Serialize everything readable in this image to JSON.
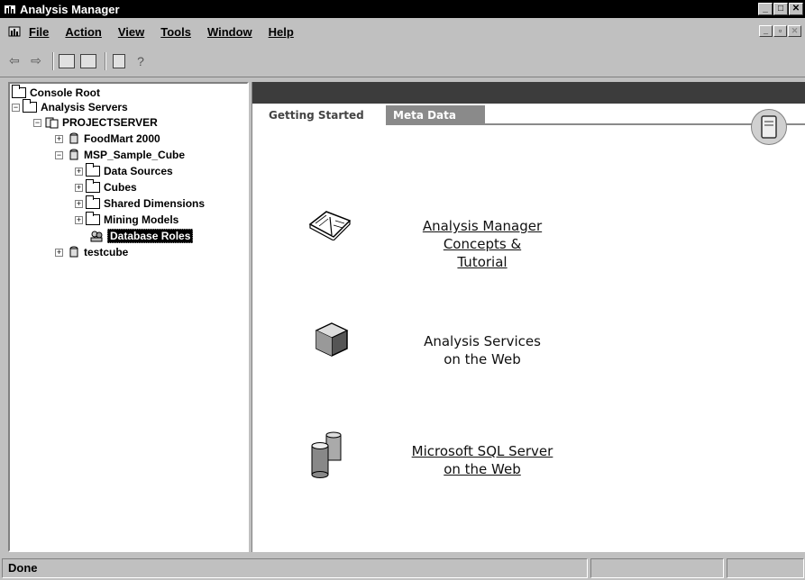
{
  "window": {
    "title": "Analysis Manager"
  },
  "menu": [
    {
      "label": "File"
    },
    {
      "label": "Action"
    },
    {
      "label": "View"
    },
    {
      "label": "Tools"
    },
    {
      "label": "Window"
    },
    {
      "label": "Help"
    }
  ],
  "tree": {
    "console_root": "Console Root",
    "analysis_servers": "Analysis Servers",
    "server": "PROJECTSERVER",
    "db_foodmart": "FoodMart 2000",
    "db_msp": "MSP_Sample_Cube",
    "data_sources": "Data Sources",
    "cubes": "Cubes",
    "shared_dimensions": "Shared Dimensions",
    "mining_models": "Mining Models",
    "database_roles": "Database Roles",
    "db_testcube": "testcube"
  },
  "tabs": {
    "getting_started": "Getting Started",
    "meta_data": "Meta Data"
  },
  "links": {
    "tutorial": [
      "Analysis Manager",
      "Concepts &",
      "Tutorial"
    ],
    "web": [
      "Analysis Services",
      "on the Web"
    ],
    "sql": [
      "Microsoft SQL Server",
      "on the Web"
    ]
  },
  "status": {
    "text": "Done"
  }
}
